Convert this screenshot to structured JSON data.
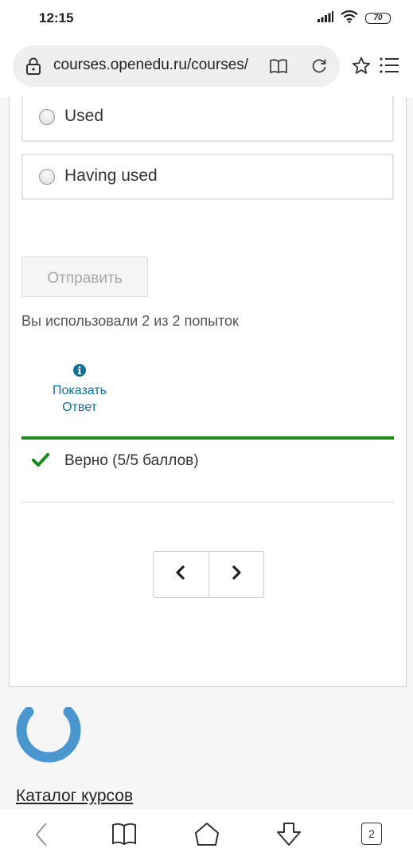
{
  "status_bar": {
    "time": "12:15",
    "battery": "70",
    "icons": [
      "signal-icon",
      "wifi-icon",
      "battery-icon"
    ]
  },
  "browser": {
    "url": "courses.openedu.ru/courses/",
    "icons": [
      "lock-icon",
      "reader-mode-icon",
      "reload-icon",
      "star-icon",
      "menu-icon"
    ]
  },
  "question": {
    "options": [
      {
        "label": "Used",
        "selected": false
      },
      {
        "label": "Having used",
        "selected": false
      }
    ]
  },
  "actions": {
    "submit_label": "Отправить",
    "attempts_text": "Вы использовали 2 из 2 попыток",
    "show_answer_line1": "Показать",
    "show_answer_line2": "Ответ"
  },
  "result": {
    "text": "Верно (5/5 баллов)",
    "color": "#1a8a1a"
  },
  "navigation": {
    "prev_icon": "chevron-left-icon",
    "next_icon": "chevron-right-icon"
  },
  "footer": {
    "catalog_link": "Каталог курсов",
    "logo_color": "#4a96cf"
  },
  "bottom_nav": {
    "tab_count": "2",
    "icons": [
      "back-icon",
      "bookmarks-icon",
      "home-icon",
      "download-icon",
      "tabs-icon"
    ]
  }
}
